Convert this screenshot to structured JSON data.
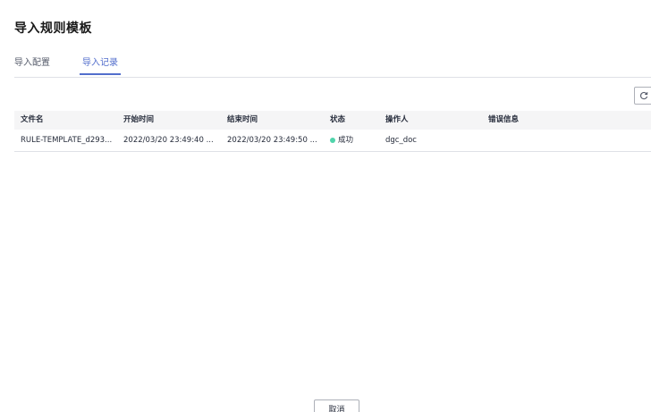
{
  "dialog": {
    "title": "导入规则模板"
  },
  "tabs": [
    {
      "label": "导入配置",
      "active": false
    },
    {
      "label": "导入记录",
      "active": true
    }
  ],
  "toolbar": {
    "refresh_icon": "refresh-icon"
  },
  "table": {
    "columns": [
      "文件名",
      "开始时间",
      "结束时间",
      "状态",
      "操作人",
      "错误信息"
    ],
    "rows": [
      {
        "file_name": "RULE-TEMPLATE_d293...",
        "start_time": "2022/03/20 23:49:40 ...",
        "end_time": "2022/03/20 23:49:50 ...",
        "status": "成功",
        "status_color": "#50d4ab",
        "operator": "dgc_doc",
        "error": ""
      }
    ]
  },
  "footer": {
    "cancel_label": "取消"
  },
  "colors": {
    "accent": "#526ecc",
    "border": "#dfe1e6",
    "header_bg": "#f5f5f6"
  }
}
